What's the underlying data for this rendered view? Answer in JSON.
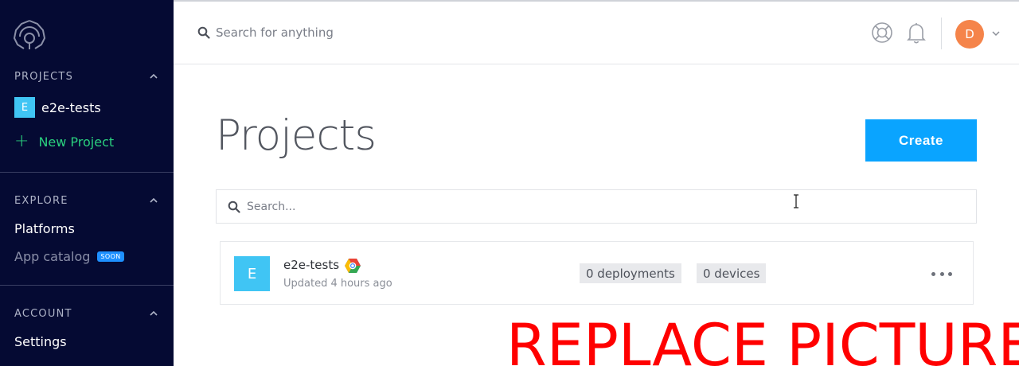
{
  "sidebar": {
    "sections": [
      {
        "label": "PROJECTS"
      },
      {
        "label": "EXPLORE"
      },
      {
        "label": "ACCOUNT"
      }
    ],
    "projects": [
      {
        "initial": "E",
        "name": "e2e-tests"
      }
    ],
    "new_project_label": "New Project",
    "explore_items": [
      {
        "label": "Platforms"
      },
      {
        "label": "App catalog",
        "badge": "SOON"
      }
    ],
    "account_items": [
      {
        "label": "Settings"
      }
    ]
  },
  "topbar": {
    "search_placeholder": "Search for anything",
    "user_initial": "D"
  },
  "main": {
    "title": "Projects",
    "create_label": "Create",
    "search_placeholder": "Search...",
    "projects": [
      {
        "initial": "E",
        "name": "e2e-tests",
        "updated": "Updated 4 hours ago",
        "deployments": "0 deployments",
        "devices": "0 devices"
      }
    ]
  },
  "overlay_text": "REPLACE PICTURE",
  "colors": {
    "sidebar_bg": "#050a33",
    "accent": "#0aa4ff",
    "new_project": "#2ad07e",
    "project_avatar": "#40c5f4",
    "user_avatar": "#f5844a",
    "overlay": "#ff0000"
  }
}
